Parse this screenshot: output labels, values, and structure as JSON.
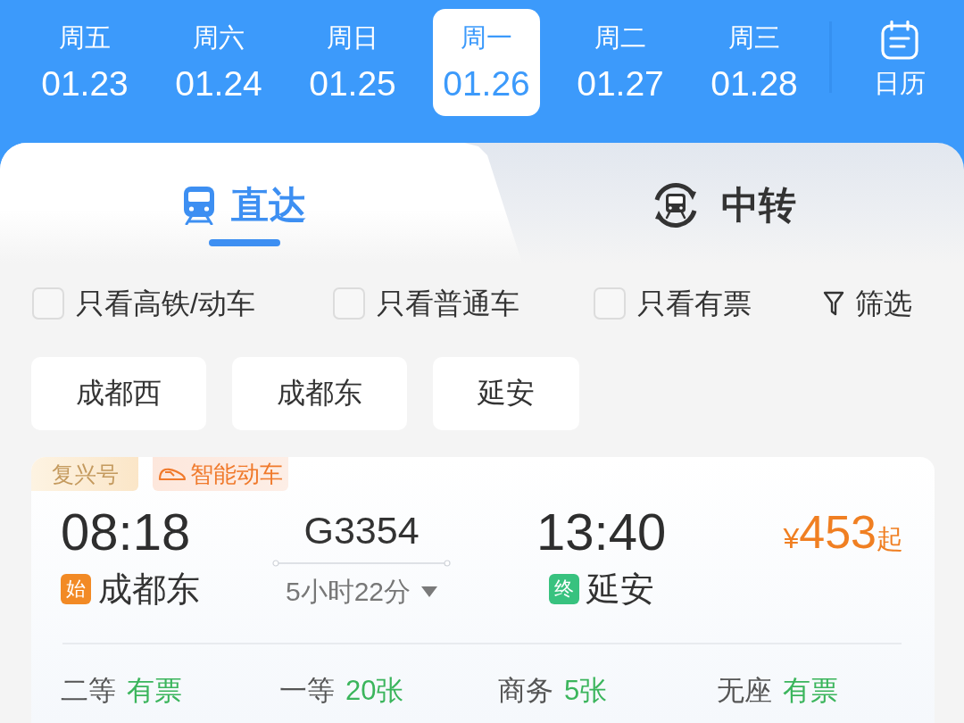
{
  "date_bar": {
    "days": [
      {
        "weekday": "周五",
        "date": "01.23",
        "selected": false
      },
      {
        "weekday": "周六",
        "date": "01.24",
        "selected": false
      },
      {
        "weekday": "周日",
        "date": "01.25",
        "selected": false
      },
      {
        "weekday": "周一",
        "date": "01.26",
        "selected": true
      },
      {
        "weekday": "周二",
        "date": "01.27",
        "selected": false
      },
      {
        "weekday": "周三",
        "date": "01.28",
        "selected": false
      }
    ],
    "calendar": {
      "label": "日历"
    }
  },
  "tabs": [
    {
      "kind": "direct",
      "label": "直达",
      "selected": true
    },
    {
      "kind": "transfer",
      "label": "中转",
      "selected": false
    }
  ],
  "filters": [
    {
      "label": "只看高铁/动车",
      "checked": false
    },
    {
      "label": "只看普通车",
      "checked": false
    },
    {
      "label": "只看有票",
      "checked": false
    }
  ],
  "filter_button": {
    "label": "筛选"
  },
  "stations": [
    {
      "label": "成都西"
    },
    {
      "label": "成都东"
    },
    {
      "label": "延安"
    }
  ],
  "trains": [
    {
      "tags": [
        {
          "kind": "brand",
          "label": "复兴号"
        },
        {
          "kind": "feature",
          "label": "智能动车"
        }
      ],
      "departure": {
        "time": "08:18",
        "badge": "始",
        "station": "成都东"
      },
      "train_number": "G3354",
      "duration": "5小时22分",
      "arrival": {
        "time": "13:40",
        "badge": "终",
        "station": "延安"
      },
      "price": {
        "currency": "¥",
        "amount": "453",
        "suffix": "起"
      },
      "seats": [
        {
          "class": "二等",
          "availability": "有票"
        },
        {
          "class": "一等",
          "availability": "20张"
        },
        {
          "class": "商务",
          "availability": "5张"
        },
        {
          "class": "无座",
          "availability": "有票"
        }
      ]
    }
  ]
}
